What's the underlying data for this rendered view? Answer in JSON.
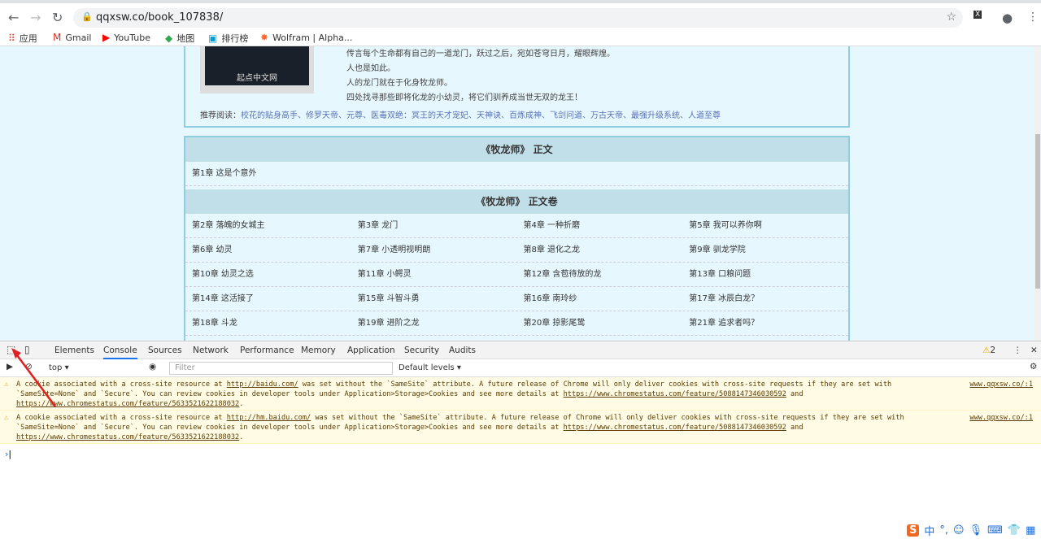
{
  "browser": {
    "url": "qqxsw.co/book_107838/",
    "nav": [
      "back",
      "forward",
      "reload"
    ]
  },
  "bookmarks": [
    {
      "label": "应用",
      "icon": "apps-grid-icon"
    },
    {
      "label": "Gmail",
      "icon": "gmail-icon"
    },
    {
      "label": "YouTube",
      "icon": "youtube-icon"
    },
    {
      "label": "地图",
      "icon": "maps-icon"
    },
    {
      "label": "排行榜",
      "icon": "bilibili-icon"
    },
    {
      "label": "Wolfram | Alpha...",
      "icon": "wolfram-icon"
    }
  ],
  "intro": {
    "cover_text": "起点中文网",
    "lines": [
      "传言每个生命都有自己的一道龙门，跃过之后，宛如苍穹日月，耀眼辉煌。",
      "人也是如此。",
      "人的龙门就在于化身牧龙师。",
      "四处找寻那些即将化龙的小幼灵，将它们驯养成当世无双的龙王！"
    ],
    "recommend_label": "推荐阅读：",
    "recommend_links": "校花的贴身高手、修罗天帝、元尊、医毒双绝：冥王的天才宠妃、天神诀、百炼成神、飞剑问道、万古天帝、最强升级系统、人道至尊"
  },
  "chapters": {
    "section1": "《牧龙师》  正文",
    "section1_rows": [
      [
        "第1章  这是个意外"
      ]
    ],
    "section2": "《牧龙师》  正文卷",
    "section2_rows": [
      [
        "第2章  落魄的女城主",
        "第3章  龙门",
        "第4章  一种折磨",
        "第5章  我可以养你啊"
      ],
      [
        "第6章  幼灵",
        "第7章  小透明视明朗",
        "第8章  退化之龙",
        "第9章  驯龙学院"
      ],
      [
        "第10章  幼灵之选",
        "第11章  小鳄灵",
        "第12章  含苞待放的龙",
        "第13章  口粮问题"
      ],
      [
        "第14章  这活接了",
        "第15章  斗智斗勇",
        "第16章  南玲纱",
        "第17章  冰辰白龙？"
      ],
      [
        "第18章  斗龙",
        "第19章  进阶之龙",
        "第20章  掠影尾鸷",
        "第21章  追求者吗？"
      ]
    ]
  },
  "devtools": {
    "tabs": [
      "Elements",
      "Console",
      "Sources",
      "Network",
      "Performance",
      "Memory",
      "Application",
      "Security",
      "Audits"
    ],
    "active_tab": "Console",
    "warning_count": "2",
    "context": "top",
    "filter_placeholder": "Filter",
    "levels": "Default levels",
    "messages": [
      {
        "pre": "A cookie associated with a cross-site resource at ",
        "link": "http://baidu.com/",
        "post": " was set without the `SameSite` attribute. A future release of Chrome will only deliver cookies with cross-site requests if they are set with `SameSite=None` and `Secure`. You can review cookies in developer tools under Application>Storage>Cookies and see more details at ",
        "link2": "https://www.chromestatus.com/feature/5088147346030592",
        "and": " and ",
        "link3": "https://www.chromestatus.com/feature/5633521622188032",
        "end": ".",
        "source": "www.qqxsw.co/:1"
      },
      {
        "pre": "A cookie associated with a cross-site resource at ",
        "link": "http://hm.baidu.com/",
        "post": " was set without the `SameSite` attribute. A future release of Chrome will only deliver cookies with cross-site requests if they are set with `SameSite=None` and `Secure`. You can review cookies in developer tools under Application>Storage>Cookies and see more details at ",
        "link2": "https://www.chromestatus.com/feature/5088147346030592",
        "and": " and ",
        "link3": "https://www.chromestatus.com/feature/5633521622188032",
        "end": ".",
        "source": "www.qqxsw.co/:1"
      }
    ]
  },
  "ime": {
    "label": "中"
  },
  "colors": {
    "page_bg": "#e6f7fd",
    "border": "#91cde0",
    "header_bg": "#c0dfe9",
    "link": "#5a72b6",
    "warning_bg": "#fffbe5",
    "accent": "#1a73e8"
  }
}
